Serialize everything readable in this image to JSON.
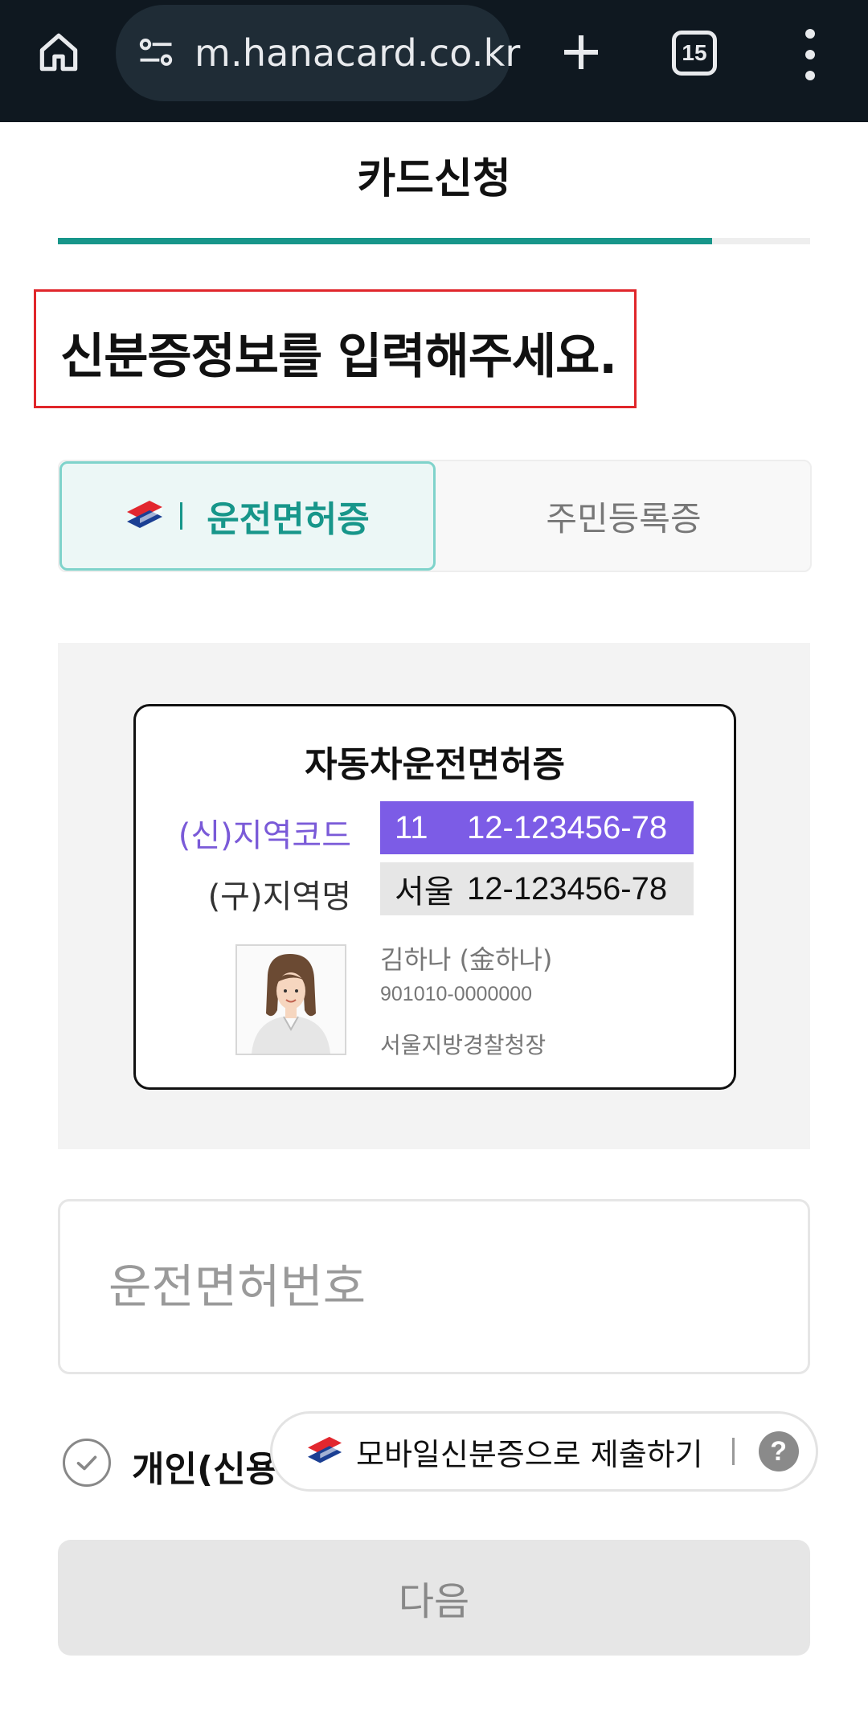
{
  "browser": {
    "url": "m.hanacard.co.kr",
    "tab_count": "15",
    "icons": [
      "home-icon",
      "site-settings-icon",
      "plus-icon",
      "tab-switcher-icon",
      "more-vert-icon"
    ]
  },
  "header": {
    "title": "카드신청",
    "progress_percent": 87
  },
  "heading": "신분증정보를 입력해주세요.",
  "id_tabs": [
    {
      "label": "운전면허증",
      "selected": true
    },
    {
      "label": "주민등록증",
      "selected": false
    }
  ],
  "license_sample": {
    "title": "자동차운전면허증",
    "new_row": {
      "label": "(신)지역코드",
      "region": "11",
      "number": "12-123456-78"
    },
    "old_row": {
      "label": "(구)지역명",
      "region": "서울",
      "number": "12-123456-78"
    },
    "holder_name": "김하나 (金하나)",
    "holder_id": "901010-0000000",
    "issuer": "서울지방경찰청장"
  },
  "license_input": {
    "placeholder": "운전면허번호",
    "value": ""
  },
  "agreement": {
    "label": "개인(신용",
    "checked": false
  },
  "mobile_id": {
    "label": "모바일신분증으로 제출하기",
    "help": "?"
  },
  "next_button": {
    "label": "다음",
    "enabled": false
  },
  "colors": {
    "accent": "#17968a",
    "highlight": "#7c5ce6",
    "alert_border": "#e0262b"
  }
}
